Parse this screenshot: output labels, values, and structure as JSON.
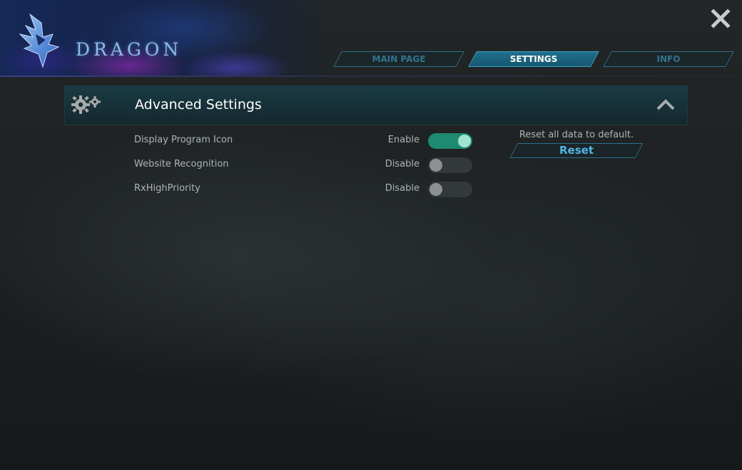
{
  "app": {
    "logo_text": "DRAGON",
    "brand_color": "#8fb9e6"
  },
  "tabs": [
    {
      "label": "MAIN PAGE",
      "active": false
    },
    {
      "label": "SETTINGS",
      "active": true
    },
    {
      "label": "INFO",
      "active": false
    }
  ],
  "section": {
    "title": "Advanced Settings",
    "icon": "gears-icon",
    "collapse_icon": "chevron-up-icon"
  },
  "settings": [
    {
      "label": "Display Program Icon",
      "status": "Enable",
      "enabled": true
    },
    {
      "label": "Website Recognition",
      "status": "Disable",
      "enabled": false
    },
    {
      "label": "RxHighPriority",
      "status": "Disable",
      "enabled": false
    }
  ],
  "reset": {
    "description": "Reset all data to default.",
    "button_label": "Reset"
  },
  "colors": {
    "accent": "#1d8a72",
    "tab_active": "#1f6f8e",
    "link": "#4fb6e6"
  }
}
